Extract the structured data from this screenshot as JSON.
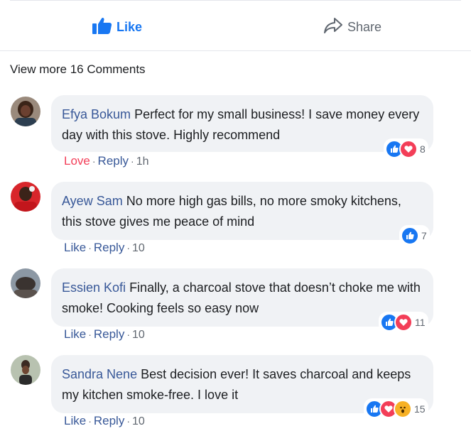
{
  "post_actions": {
    "like_label": "Like",
    "share_label": "Share"
  },
  "view_more": "View more 16 Comments",
  "colors": {
    "accent": "#1877f2",
    "love": "#f33e58",
    "name": "#385898"
  },
  "comments": [
    {
      "author": "Efya Bokum",
      "text": "Perfect for my small business! I save money every day with this stove. Highly recommend",
      "reaction_label": "Love",
      "reply_label": "Reply",
      "time": "1h",
      "reactions": [
        "like-icon",
        "love-icon"
      ],
      "count": "8"
    },
    {
      "author": "Ayew Sam",
      "text": "No more high gas bills, no more smoky kitchens, this stove gives me peace of mind",
      "reaction_label": "Like",
      "reply_label": "Reply",
      "time": "10",
      "reactions": [
        "like-icon"
      ],
      "count": "7"
    },
    {
      "author": "Essien Kofi",
      "text": "Finally, a charcoal stove that doesn’t choke me with smoke! Cooking feels so easy now",
      "reaction_label": "Like",
      "reply_label": "Reply",
      "time": "10",
      "reactions": [
        "like-icon",
        "love-icon"
      ],
      "count": "11"
    },
    {
      "author": "Sandra Nene",
      "text": "Best decision ever! It saves charcoal and keeps my kitchen smoke-free. I love it",
      "reaction_label": "Like",
      "reply_label": "Reply",
      "time": "10",
      "reactions": [
        "like-icon",
        "love-icon",
        "wow-icon"
      ],
      "count": "15"
    }
  ]
}
